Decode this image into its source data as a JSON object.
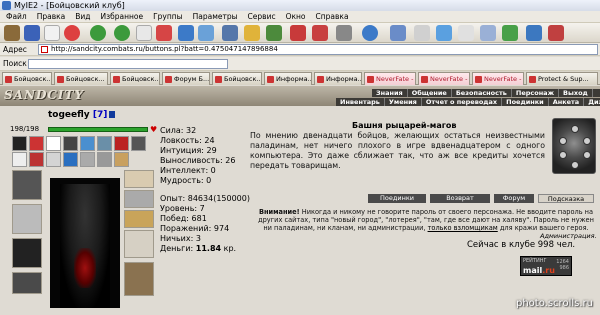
{
  "window": {
    "title": "MyIE2 - [Бойцовский клуб]"
  },
  "menu": [
    "Файл",
    "Правка",
    "Вид",
    "Избранное",
    "Группы",
    "Параметры",
    "Сервис",
    "Окно",
    "Справка"
  ],
  "address": {
    "label": "Адрес",
    "url": "http://sandcity.combats.ru/buttons.pl?batt=0.475047147896884"
  },
  "search": {
    "label": "Поиск"
  },
  "tabs": [
    "Бойцовск...",
    "Бойцовск...",
    "Бойцовск...",
    "Форум Б...",
    "Бойцовск...",
    "Информа...",
    "Информа...",
    "NeverFate - в...",
    "NeverFate - ...",
    "NeverFate - в...",
    "Protect & Sup..."
  ],
  "game": {
    "logo": "SANDCITY",
    "nav_top": [
      "Знания",
      "Общение",
      "Безопасность",
      "Персонаж",
      "Выход"
    ],
    "nav_bottom": [
      "Инвентарь",
      "Умения",
      "Отчет о переводах",
      "Поединки",
      "Анкета",
      "Дизайн"
    ]
  },
  "character": {
    "name": "togeefly",
    "level": "[7]",
    "hp": "198/198"
  },
  "stats": {
    "strength": "Сила: 32",
    "agility": "Ловкость: 24",
    "intuition": "Интуиция: 29",
    "endurance": "Выносливость: 26",
    "intellect": "Интеллект: 0",
    "wisdom": "Мудрость: 0"
  },
  "stats2": {
    "exp": "Опыт: 84634(150000)",
    "level": "Уровень: 7",
    "wins": "Побед: 681",
    "losses": "Поражений: 974",
    "draws": "Ничьих: 3",
    "money_label": "Деньги:",
    "money_value": "11.84",
    "money_unit": "кр."
  },
  "location": {
    "title": "Башня рыцарей-магов",
    "text": "По мнению двенадцати бойцов, желающих остаться неизвестными паладинам, нет ничего плохого в игре вдвенадцатером с одного компьютера. Это даже сближает так, что аж все кредиты хочется передать товарищам."
  },
  "actions": [
    "Поединки",
    "Возврат",
    "Форум",
    "Подсказка"
  ],
  "warning": {
    "bold": "Внимание!",
    "text": " Никогда и никому не говорите пароль от своего персонажа. Не вводите пароль на других сайтах, типа \"новый город\", \"лотерея\", \"там, где все дают на халяву\". Пароль не нужен ни паладинам, ни кланам, ни администрации,",
    "link": "только взломщикам",
    "tail": " для кражи вашего героя.",
    "admin": "Администрация."
  },
  "online": "Сейчас в клубе 998 чел.",
  "counter": {
    "top": "РЕЙТИНГ",
    "brand1": "mail",
    "brand2": ".ru",
    "right": "1264\n986"
  },
  "watermark": "photo.scrolls.ru"
}
